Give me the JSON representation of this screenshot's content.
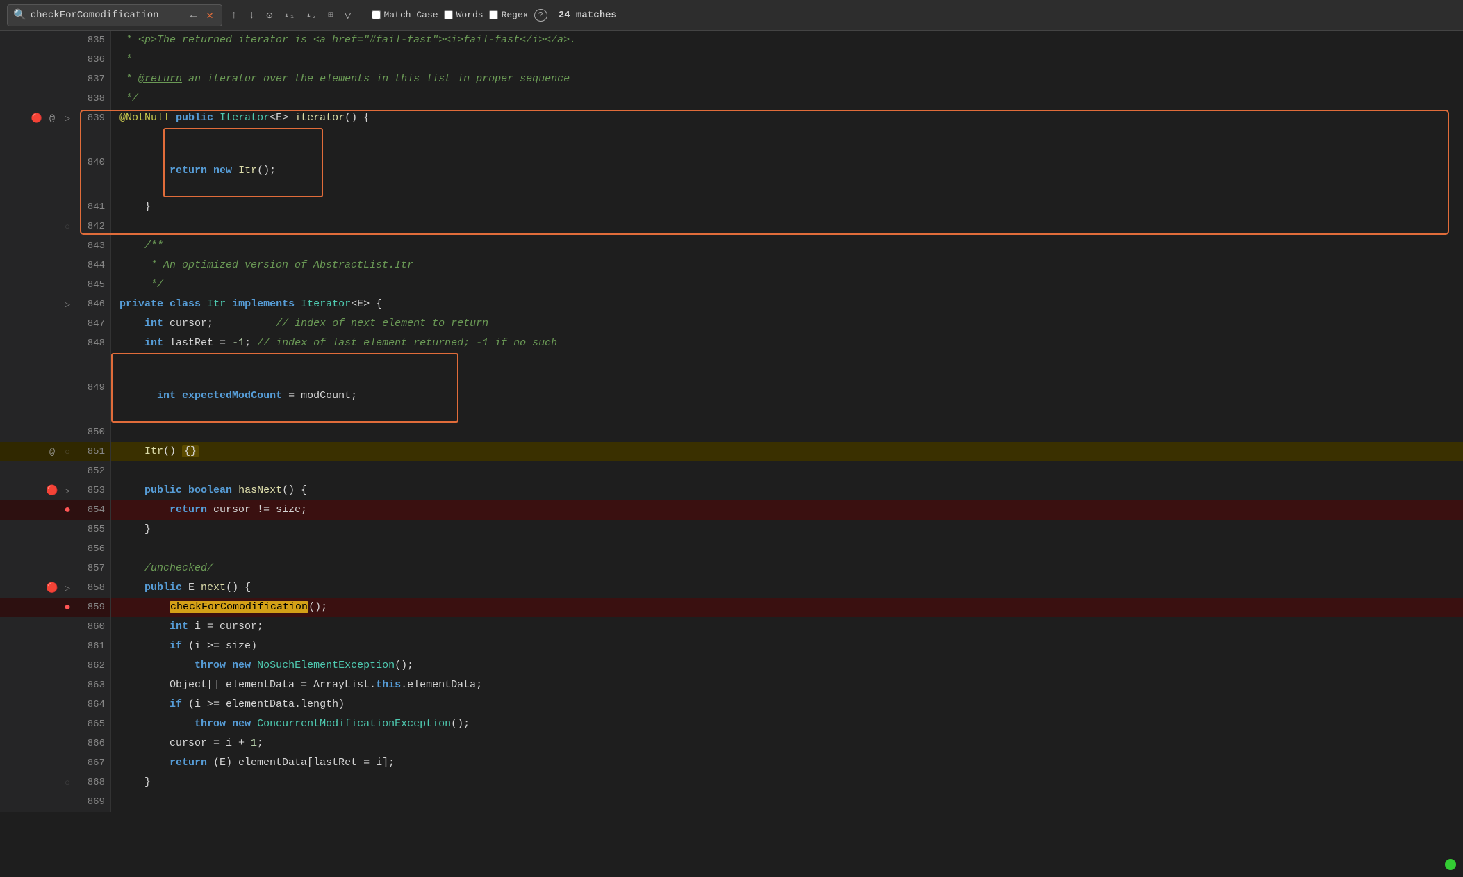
{
  "toolbar": {
    "search_placeholder": "checkForComodification",
    "search_value": "checkForComodification",
    "nav_left": "←",
    "nav_right": "→",
    "nav_up": "↑",
    "nav_down": "↓",
    "nav_all": "⊙",
    "match_case_label": "Match Case",
    "words_label": "Words",
    "regex_label": "Regex",
    "help_label": "?",
    "match_count": "24 matches"
  },
  "lines": [
    {
      "num": 835,
      "gutter": [],
      "content": " * <p>The returned iterator is <a href=\"#fail-fast\"><i>fail-fast</i></a>.",
      "type": "comment"
    },
    {
      "num": 836,
      "gutter": [],
      "content": " *",
      "type": "comment"
    },
    {
      "num": 837,
      "gutter": [],
      "content": " * @return an iterator over the elements in this list in proper sequence",
      "type": "comment"
    },
    {
      "num": 838,
      "gutter": [],
      "content": " */",
      "type": "comment"
    },
    {
      "num": 839,
      "gutter": [
        "debug",
        "fold"
      ],
      "content": "839_special",
      "type": "special"
    },
    {
      "num": 840,
      "gutter": [],
      "content": "840_special",
      "type": "special"
    },
    {
      "num": 841,
      "gutter": [],
      "content": "841_special",
      "type": "special"
    },
    {
      "num": 842,
      "gutter": [],
      "content": "",
      "type": "plain"
    },
    {
      "num": 843,
      "gutter": [],
      "content": "    /**",
      "type": "comment"
    },
    {
      "num": 844,
      "gutter": [],
      "content": "     * An optimized version of AbstractList.Itr",
      "type": "comment"
    },
    {
      "num": 845,
      "gutter": [],
      "content": "     */",
      "type": "comment"
    },
    {
      "num": 846,
      "gutter": [
        "fold"
      ],
      "content": "846_special",
      "type": "special"
    },
    {
      "num": 847,
      "gutter": [],
      "content": "847_special",
      "type": "special"
    },
    {
      "num": 848,
      "gutter": [],
      "content": "848_special",
      "type": "special"
    },
    {
      "num": 849,
      "gutter": [],
      "content": "849_special",
      "type": "special"
    },
    {
      "num": 850,
      "gutter": [],
      "content": "",
      "type": "plain"
    },
    {
      "num": 851,
      "gutter": [
        "at"
      ],
      "content": "851_special",
      "type": "special",
      "bg": "yellow"
    },
    {
      "num": 852,
      "gutter": [],
      "content": "",
      "type": "plain"
    },
    {
      "num": 853,
      "gutter": [
        "debug"
      ],
      "content": "853_special",
      "type": "special"
    },
    {
      "num": 854,
      "gutter": [
        "breakpoint"
      ],
      "content": "854_special",
      "type": "special",
      "bg": "pink"
    },
    {
      "num": 855,
      "gutter": [],
      "content": "    }",
      "type": "plain"
    },
    {
      "num": 856,
      "gutter": [],
      "content": "",
      "type": "plain"
    },
    {
      "num": 857,
      "gutter": [],
      "content": "    /unchecked/",
      "type": "comment2"
    },
    {
      "num": 858,
      "gutter": [
        "debug"
      ],
      "content": "858_special",
      "type": "special"
    },
    {
      "num": 859,
      "gutter": [
        "breakpoint"
      ],
      "content": "859_special",
      "type": "special",
      "bg": "pink"
    },
    {
      "num": 860,
      "gutter": [],
      "content": "860_special",
      "type": "special"
    },
    {
      "num": 861,
      "gutter": [],
      "content": "861_special",
      "type": "special"
    },
    {
      "num": 862,
      "gutter": [],
      "content": "862_special",
      "type": "special"
    },
    {
      "num": 863,
      "gutter": [],
      "content": "863_special",
      "type": "special"
    },
    {
      "num": 864,
      "gutter": [],
      "content": "864_special",
      "type": "special"
    },
    {
      "num": 865,
      "gutter": [],
      "content": "865_special",
      "type": "special"
    },
    {
      "num": 866,
      "gutter": [],
      "content": "866_special",
      "type": "special"
    },
    {
      "num": 867,
      "gutter": [],
      "content": "867_special",
      "type": "special"
    },
    {
      "num": 868,
      "gutter": [
        "fold"
      ],
      "content": "    }",
      "type": "plain"
    },
    {
      "num": 869,
      "gutter": [],
      "content": "",
      "type": "plain"
    }
  ]
}
